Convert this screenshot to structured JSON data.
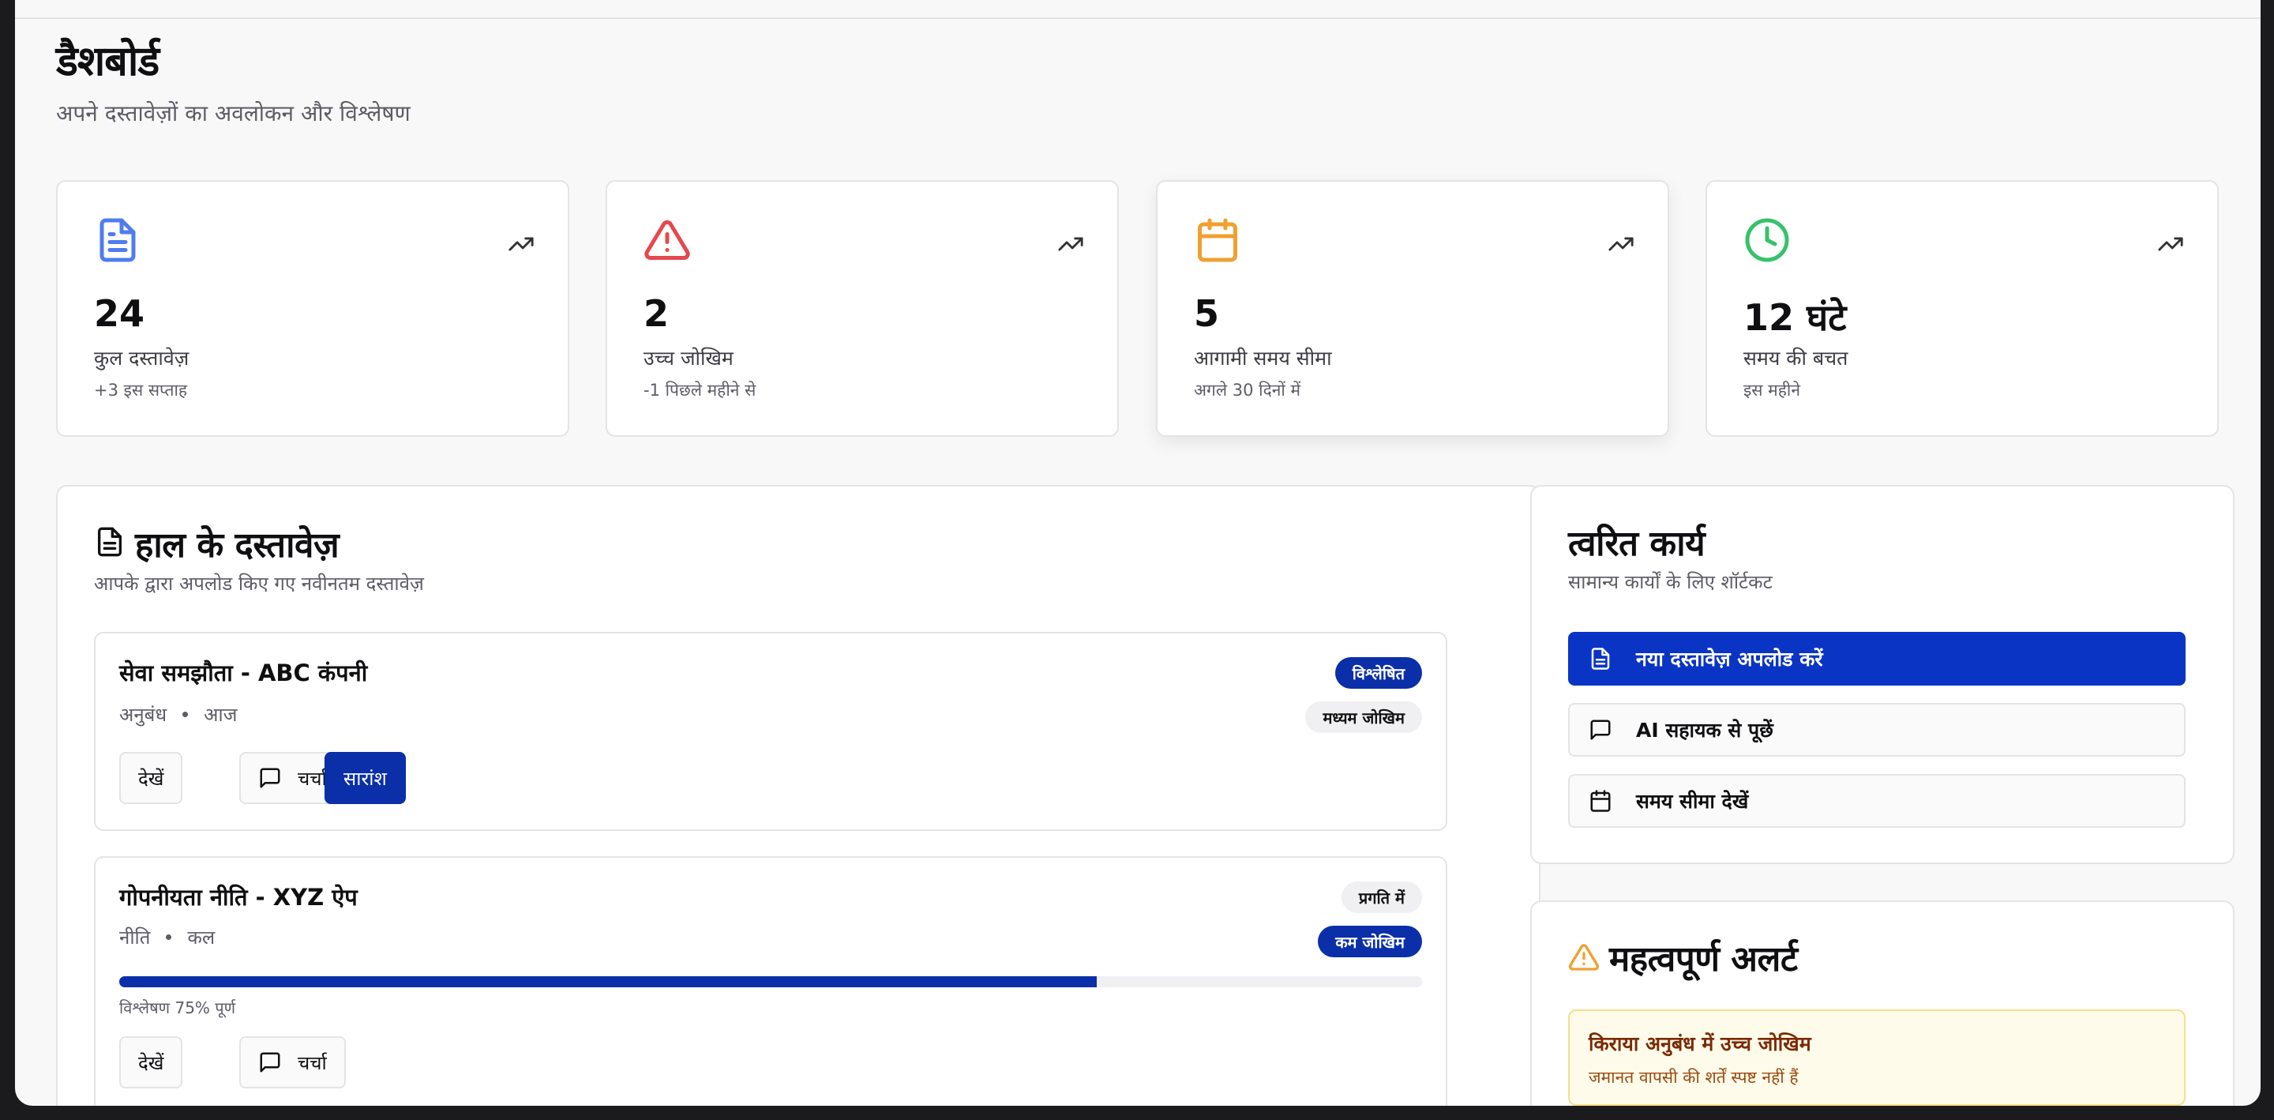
{
  "header": {
    "title": "डैशबोर्ड",
    "subtitle": "अपने दस्तावेज़ों का अवलोकन और विश्लेषण"
  },
  "stats": [
    {
      "icon": "document-icon",
      "color": "#4f7cf0",
      "value": "24",
      "label": "कुल दस्तावेज़",
      "sub": "+3 इस सप्ताह"
    },
    {
      "icon": "warning-triangle-icon",
      "color": "#e5484d",
      "value": "2",
      "label": "उच्च जोखिम",
      "sub": "-1 पिछले महीने से"
    },
    {
      "icon": "calendar-icon",
      "color": "#f0a030",
      "value": "5",
      "label": "आगामी समय सीमा",
      "sub": "अगले 30 दिनों में"
    },
    {
      "icon": "clock-icon",
      "color": "#36c26a",
      "value": "12 घंटे",
      "label": "समय की बचत",
      "sub": "इस महीने"
    }
  ],
  "recent": {
    "title": "हाल के दस्तावेज़",
    "subtitle": "आपके द्वारा अपलोड किए गए नवीनतम दस्तावेज़",
    "documents": [
      {
        "name": "सेवा समझौता - ABC कंपनी",
        "type": "अनुबंध",
        "date": "आज",
        "status": "विश्लेषित",
        "risk": "मध्यम जोखिम",
        "actions": {
          "view": "देखें",
          "chat": "चर्चा",
          "summary": "सारांश"
        }
      },
      {
        "name": "गोपनीयता नीति - XYZ ऐप",
        "type": "नीति",
        "date": "कल",
        "status": "प्रगति में",
        "risk": "कम जोखिम",
        "progress": 0.75,
        "progress_label": "विश्लेषण 75% पूर्ण",
        "actions": {
          "view": "देखें",
          "chat": "चर्चा"
        }
      }
    ]
  },
  "quick_actions": {
    "title": "त्वरित कार्य",
    "subtitle": "सामान्य कार्यों के लिए शॉर्टकट",
    "items": [
      {
        "icon": "document-icon",
        "label": "नया दस्तावेज़ अपलोड करें"
      },
      {
        "icon": "chat-icon",
        "label": "AI सहायक से पूछें"
      },
      {
        "icon": "calendar-icon",
        "label": "समय सीमा देखें"
      }
    ]
  },
  "alerts": {
    "title": "महत्वपूर्ण अलर्ट",
    "items": [
      {
        "title": "किराया अनुबंध में उच्च जोखिम",
        "desc": "जमानत वापसी की शर्तें स्पष्ट नहीं हैं"
      }
    ]
  },
  "colors": {
    "primary": "#0a2fa8",
    "alert_bg": "#fffbea",
    "alert_border": "#f5df8a",
    "warning": "#f0a030"
  }
}
